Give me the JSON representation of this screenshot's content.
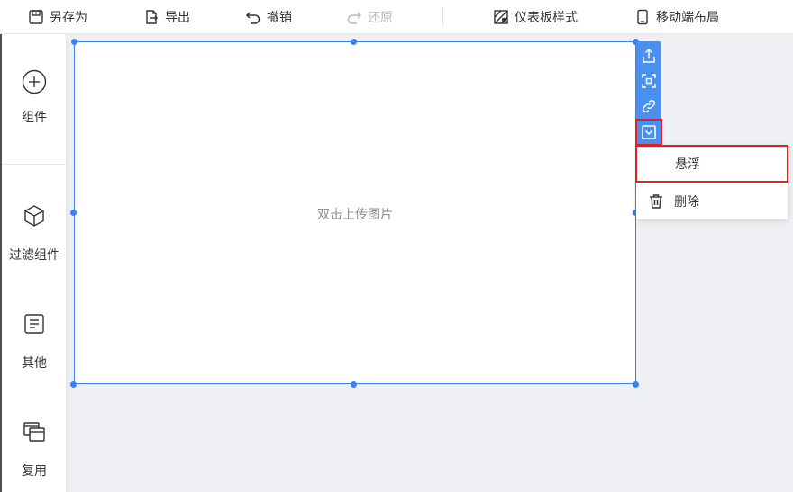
{
  "toolbar": {
    "save_as": "另存为",
    "export": "导出",
    "undo": "撤销",
    "redo": "还原",
    "dashboard_style": "仪表板样式",
    "mobile_layout": "移动端布局"
  },
  "sidebar": {
    "items": [
      {
        "label": "组件",
        "icon": "plus-circle-icon"
      },
      {
        "label": "过滤组件",
        "icon": "cube-icon"
      },
      {
        "label": "其他",
        "icon": "document-icon"
      },
      {
        "label": "复用",
        "icon": "windows-icon"
      }
    ]
  },
  "widget": {
    "placeholder": "双击上传图片"
  },
  "widget_tools": [
    "export-icon",
    "focus-icon",
    "link-icon",
    "chevron-down-icon"
  ],
  "dropdown": {
    "float": "悬浮",
    "delete": "删除"
  },
  "colors": {
    "accent": "#3b82f6",
    "tool_bg": "#4a90f0",
    "highlight": "#e02020",
    "canvas_bg": "#eef0f4"
  }
}
